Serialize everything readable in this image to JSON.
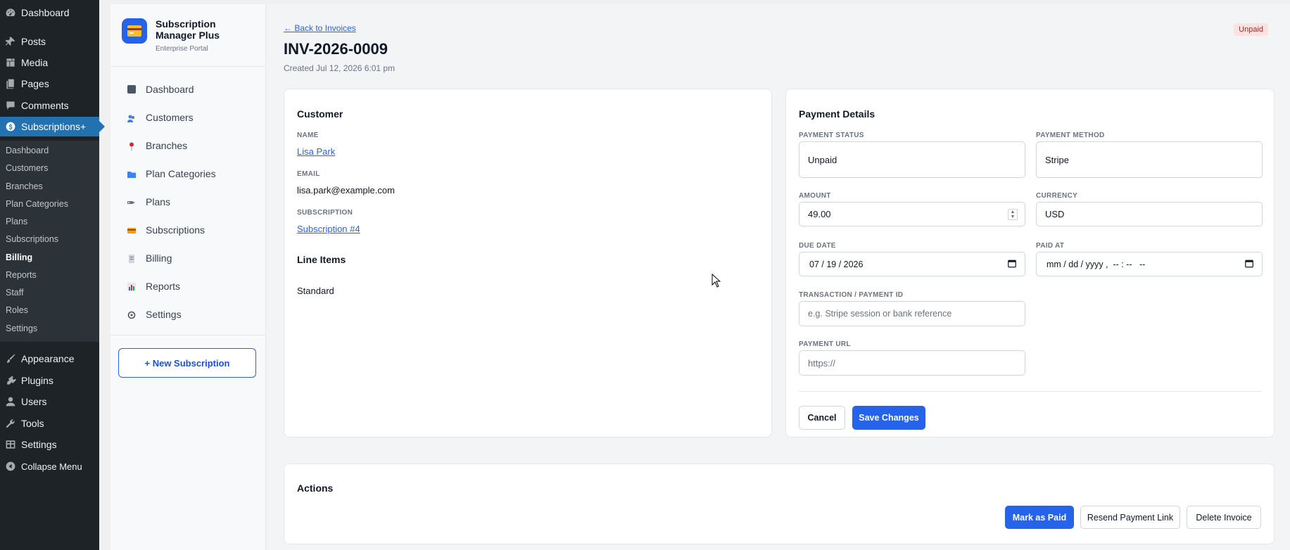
{
  "wp_menu": {
    "items": [
      {
        "label": "Dashboard",
        "icon": "dashboard-icon"
      },
      {
        "label": "Posts",
        "icon": "pin-icon"
      },
      {
        "label": "Media",
        "icon": "media-icon"
      },
      {
        "label": "Pages",
        "icon": "pages-icon"
      },
      {
        "label": "Comments",
        "icon": "comments-icon"
      },
      {
        "label": "Subscriptions+",
        "icon": "dollar-icon"
      },
      {
        "label": "Appearance",
        "icon": "brush-icon"
      },
      {
        "label": "Plugins",
        "icon": "plugin-icon"
      },
      {
        "label": "Users",
        "icon": "user-icon"
      },
      {
        "label": "Tools",
        "icon": "wrench-icon"
      },
      {
        "label": "Settings",
        "icon": "settings-icon"
      },
      {
        "label": "Collapse Menu",
        "icon": "collapse-icon"
      }
    ],
    "submenu": [
      "Dashboard",
      "Customers",
      "Branches",
      "Plan Categories",
      "Plans",
      "Subscriptions",
      "Billing",
      "Reports",
      "Staff",
      "Roles",
      "Settings"
    ]
  },
  "plugin_nav": {
    "brand_name": "Subscription Manager Plus",
    "brand_sub": "Enterprise Portal",
    "items": [
      "Dashboard",
      "Customers",
      "Branches",
      "Plan Categories",
      "Plans",
      "Subscriptions",
      "Billing",
      "Reports",
      "Settings"
    ],
    "new_subscription": "+  New Subscription"
  },
  "header": {
    "back_link": "← Back to Invoices",
    "title": "INV-2026-0009",
    "created": "Created Jul 12, 2026 6:01 pm",
    "status": "Unpaid"
  },
  "customer": {
    "title": "Customer",
    "name_label": "NAME",
    "name": "Lisa Park",
    "email_label": "EMAIL",
    "email": "lisa.park@example.com",
    "subscription_label": "SUBSCRIPTION",
    "subscription": "Subscription #4",
    "line_items_title": "Line Items",
    "line_item": "Standard"
  },
  "payment": {
    "title": "Payment Details",
    "status_label": "PAYMENT STATUS",
    "status": "Unpaid",
    "method_label": "PAYMENT METHOD",
    "method": "Stripe",
    "amount_label": "AMOUNT",
    "amount": "49.00",
    "currency_label": "CURRENCY",
    "currency": "USD",
    "due_label": "DUE DATE",
    "due": "07 / 19 / 2026",
    "paid_label": "PAID AT",
    "paid": "mm / dd / yyyy ,  -- : --   --",
    "txn_label": "TRANSACTION / PAYMENT ID",
    "txn_placeholder": "e.g. Stripe session or bank reference",
    "url_label": "PAYMENT URL",
    "url_placeholder": "https://",
    "cancel": "Cancel",
    "save": "Save Changes"
  },
  "actions": {
    "title": "Actions",
    "mark_paid": "Mark as Paid",
    "resend": "Resend Payment Link",
    "delete": "Delete Invoice"
  },
  "colors": {
    "accent": "#2563eb",
    "wp_dark": "#1d2327",
    "wp_blue": "#2271b1",
    "danger_text": "#b91c1c"
  }
}
